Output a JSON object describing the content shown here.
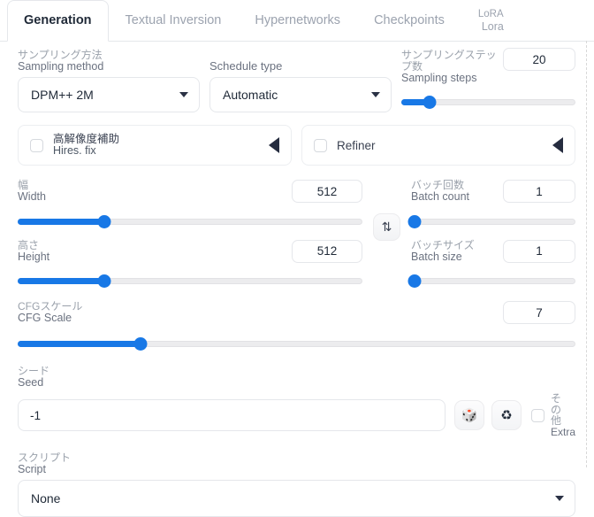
{
  "tabs": [
    {
      "label": "Generation",
      "active": true
    },
    {
      "label": "Textual Inversion",
      "active": false
    },
    {
      "label": "Hypernetworks",
      "active": false
    },
    {
      "label": "Checkpoints",
      "active": false
    },
    {
      "ja": "LoRA",
      "en": "Lora",
      "active": false
    }
  ],
  "sampling_method": {
    "label_ja": "サンプリング方法",
    "label_en": "Sampling method",
    "value": "DPM++ 2M"
  },
  "schedule_type": {
    "label_en": "Schedule type",
    "value": "Automatic"
  },
  "sampling_steps": {
    "label_ja": "サンプリングステップ数",
    "label_en": "Sampling steps",
    "value": "20",
    "percent": 16
  },
  "hires_fix": {
    "label_ja": "高解像度補助",
    "label_en": "Hires. fix",
    "checked": false,
    "expanded": false,
    "arrow": "collapse-left-triangle-icon"
  },
  "refiner": {
    "label_en": "Refiner",
    "checked": false,
    "expanded": false,
    "arrow": "collapse-left-triangle-icon"
  },
  "width": {
    "label_ja": "幅",
    "label_en": "Width",
    "value": "512",
    "percent": 25
  },
  "height": {
    "label_ja": "高さ",
    "label_en": "Height",
    "value": "512",
    "percent": 25
  },
  "swap": {
    "icon": "swap-dimensions-icon",
    "glyph": "⇅"
  },
  "batch_count": {
    "label_ja": "バッチ回数",
    "label_en": "Batch count",
    "value": "1",
    "percent": 2
  },
  "batch_size": {
    "label_ja": "バッチサイズ",
    "label_en": "Batch size",
    "value": "1",
    "percent": 2
  },
  "cfg_scale": {
    "label_ja": "CFGスケール",
    "label_en": "CFG Scale",
    "value": "7",
    "percent": 22
  },
  "seed": {
    "label_ja": "シード",
    "label_en": "Seed",
    "value": "-1",
    "placeholder": "-1",
    "random_button": {
      "icon": "dice-icon",
      "glyph": "🎲"
    },
    "recycle_button": {
      "icon": "recycle-icon",
      "glyph": "♻"
    },
    "extra": {
      "label_ja": "その他",
      "label_en": "Extra",
      "checked": false
    }
  },
  "script": {
    "label_ja": "スクリプト",
    "label_en": "Script",
    "value": "None"
  },
  "colors": {
    "accent": "#1878e6",
    "border": "#e5e7eb",
    "text": "#1f2937",
    "muted": "#9ca3af"
  }
}
